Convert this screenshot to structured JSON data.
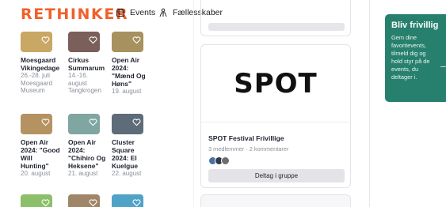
{
  "brand": {
    "logo_text": "RETHINKER",
    "accent": "#f0602a"
  },
  "nav": {
    "events_label": "Events",
    "events_icon": "calendar-icon",
    "communities_label": "Fællesskaber",
    "communities_icon": "people-icon"
  },
  "events": [
    {
      "title": "Moesgaard Vikingedage",
      "sub": "26.-28. juli Moesgaard Museum",
      "thumb": "#c9a765"
    },
    {
      "title": "Cirkus Summarum",
      "sub": "14.-16. august Tangkrogen",
      "thumb": "#7a5f5a"
    },
    {
      "title": "Open Air 2024: \"Mænd Og Høns\"",
      "sub": "19. august",
      "thumb": "#a7915f"
    },
    {
      "title": "Open Air 2024: \"Good Will Hunting\"",
      "sub": "20. august",
      "thumb": "#b59262"
    },
    {
      "title": "Open Air 2024: \"Chihiro Og Heksene\"",
      "sub": "21. august",
      "thumb": "#7fa6a0"
    },
    {
      "title": "Cluster Square 2024: El Kuelgue",
      "sub": "22. august",
      "thumb": "#5d6c78"
    },
    {
      "title": "",
      "sub": "",
      "thumb": "#8cbf6a"
    },
    {
      "title": "",
      "sub": "",
      "thumb": "#a08668"
    },
    {
      "title": "",
      "sub": "",
      "thumb": "#4fa3c6"
    }
  ],
  "group": {
    "logo_text": "SPOT",
    "name": "SPOT Festival Frivillige",
    "meta": "3 medlemmer · 2 kommentarer",
    "join_label": "Deltag i gruppe",
    "avatar_colors": [
      "#4a6fa5",
      "#2f3b4a",
      "#6e6e6e"
    ]
  },
  "cta": {
    "title": "Bliv frivillig",
    "text": "Gem dine favoritevents, tilmeld dig og hold styr på de events, du deltager i.",
    "color": "#27806d"
  }
}
